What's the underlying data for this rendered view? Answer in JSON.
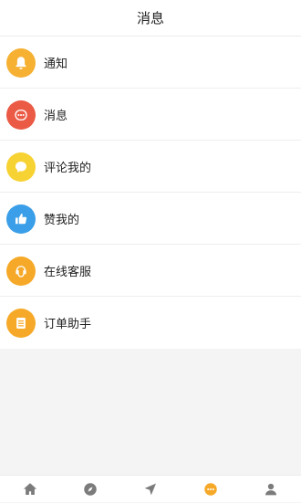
{
  "header": {
    "title": "消息"
  },
  "colors": {
    "notification": "#f6b133",
    "message": "#eb5a45",
    "comment": "#f7d233",
    "like": "#3a9ee8",
    "service": "#f6a928",
    "order": "#f6a928",
    "tab_inactive": "#7b7b7b",
    "tab_active": "#f6a928"
  },
  "list": {
    "items": [
      {
        "label": "通知",
        "icon": "bell-icon"
      },
      {
        "label": "消息",
        "icon": "chat-dots-icon"
      },
      {
        "label": "评论我的",
        "icon": "comment-bubble-icon"
      },
      {
        "label": "赞我的",
        "icon": "thumbs-up-icon"
      },
      {
        "label": "在线客服",
        "icon": "customer-service-icon"
      },
      {
        "label": "订单助手",
        "icon": "order-list-icon"
      }
    ]
  },
  "tabbar": {
    "tabs": [
      {
        "icon": "home-icon",
        "active": false
      },
      {
        "icon": "compass-icon",
        "active": false
      },
      {
        "icon": "navigation-icon",
        "active": false
      },
      {
        "icon": "message-dots-icon",
        "active": true
      },
      {
        "icon": "profile-icon",
        "active": false
      }
    ]
  }
}
